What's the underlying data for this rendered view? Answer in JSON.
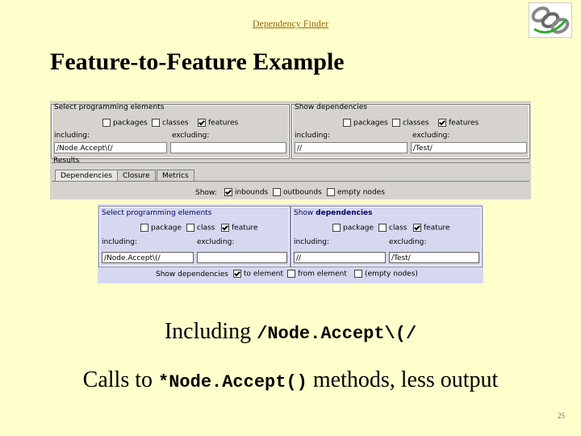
{
  "header": {
    "link": "Dependency Finder"
  },
  "title": "Feature-to-Feature Example",
  "ui_top": {
    "select_legend": "Select programming elements",
    "show_legend": "Show dependencies",
    "packages": "packages",
    "classes": "classes",
    "features": "features",
    "including": "including:",
    "excluding": "excluding:",
    "select_including_value": "/Node.Accept\\(/",
    "select_excluding_value": "",
    "show_including_value": "//",
    "show_excluding_value": "/Test/",
    "results_legend": "Results",
    "tabs": [
      "Dependencies",
      "Closure",
      "Metrics"
    ],
    "show_label": "Show:",
    "inbounds": "inbounds",
    "outbounds": "outbounds",
    "empty_nodes": "empty nodes"
  },
  "ui_bottom": {
    "select_legend": "Select programming elements",
    "show_legend_prefix": "Show ",
    "show_legend_bold": "dependencies",
    "package": "package",
    "class": "class",
    "feature": "feature",
    "including": "including:",
    "excluding": "excluding:",
    "select_including_value": "/Node.Accept\\(/",
    "select_excluding_value": "",
    "show_including_value": "//",
    "show_excluding_value": "/Test/",
    "show_deps": "Show dependencies",
    "to_element": "to element",
    "from_element": "from element",
    "empty_nodes": "(empty nodes)"
  },
  "caption1": {
    "text": "Including ",
    "code": "/Node.Accept\\(/"
  },
  "caption2": {
    "prefix": "Calls to ",
    "code": "*Node.Accept()",
    "suffix": " methods, less output"
  },
  "page_number": "25",
  "colors": {
    "background": "#ffffcc",
    "link": "#996600",
    "panel_top": "#d6d3ce",
    "panel_bottom": "#d6d8f0"
  }
}
